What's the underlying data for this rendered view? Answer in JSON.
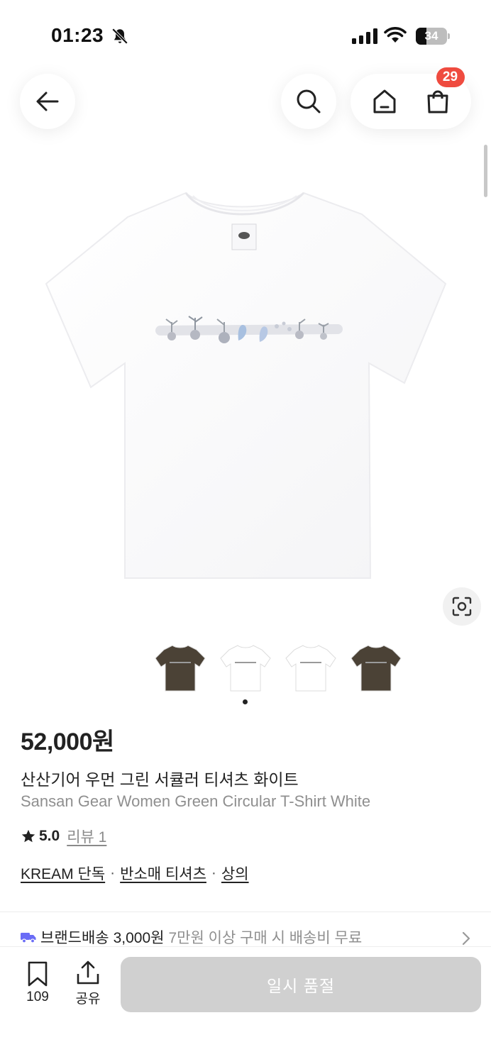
{
  "status_bar": {
    "time": "01:23",
    "battery_level": "34",
    "battery_fraction": 0.34,
    "icons": [
      "bell-off-icon",
      "signal-icon",
      "wifi-icon",
      "battery-icon"
    ]
  },
  "nav": {
    "cart_badge": "29",
    "icons": [
      "arrow-left-icon",
      "search-icon",
      "home-icon",
      "shopping-bag-icon"
    ]
  },
  "product": {
    "price": "52,000원",
    "name_ko": "산산기어 우먼 그린 서큘러 티셔츠 화이트",
    "name_en": "Sansan Gear Women Green Circular T-Shirt White",
    "rating": "5.0",
    "review_label": "리뷰 1",
    "categories": [
      "KREAM 단독",
      "반소매 티셔츠",
      "상의"
    ],
    "category_separator": "·",
    "thumbnail_colors": [
      "#4b4236",
      "#ffffff",
      "#ffffff",
      "#4b4236"
    ],
    "image_page_count": 1
  },
  "shipping": {
    "label": "브랜드배송",
    "fee": "3,000원",
    "note": "7만원 이상 구매 시 배송비 무료"
  },
  "bottom_bar": {
    "bookmark_count": "109",
    "share_label": "공유",
    "soldout_label": "일시 품절"
  },
  "colors": {
    "badge": "#ef4b3f",
    "soldout_button": "#d0d0d0",
    "muted_text": "#8f8f8f",
    "shipping_truck": "#6a6cf6"
  }
}
